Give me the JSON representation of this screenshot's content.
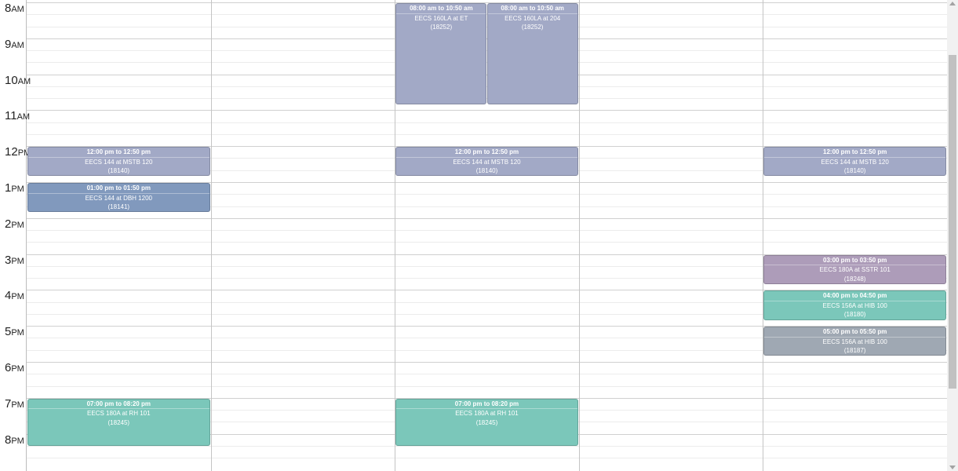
{
  "hours": [
    {
      "num": "8",
      "ampm": "AM"
    },
    {
      "num": "9",
      "ampm": "AM"
    },
    {
      "num": "10",
      "ampm": "AM"
    },
    {
      "num": "11",
      "ampm": "AM"
    },
    {
      "num": "12",
      "ampm": "PM"
    },
    {
      "num": "1",
      "ampm": "PM"
    },
    {
      "num": "2",
      "ampm": "PM"
    },
    {
      "num": "3",
      "ampm": "PM"
    },
    {
      "num": "4",
      "ampm": "PM"
    },
    {
      "num": "5",
      "ampm": "PM"
    },
    {
      "num": "6",
      "ampm": "PM"
    },
    {
      "num": "7",
      "ampm": "PM"
    },
    {
      "num": "8",
      "ampm": "PM"
    }
  ],
  "colors": {
    "blue_gray": "#a2a9c6",
    "steel_blue": "#8199bd",
    "teal": "#7bc7ba",
    "mauve": "#ad9cb9",
    "slate": "#9fa8b3"
  },
  "events": [
    {
      "id": "mon-144-a",
      "time": "12:00 pm to 12:50 pm",
      "title": "EECS 144 at MSTB 120",
      "code": "(18140)",
      "color": "blue_gray"
    },
    {
      "id": "mon-144-b",
      "time": "01:00 pm to 01:50 pm",
      "title": "EECS 144 at DBH 1200",
      "code": "(18141)",
      "color": "steel_blue"
    },
    {
      "id": "mon-180a",
      "time": "07:00 pm to 08:20 pm",
      "title": "EECS 180A at RH 101",
      "code": "(18245)",
      "color": "teal"
    },
    {
      "id": "wed-160la-et",
      "time": "08:00 am to 10:50 am",
      "title": "EECS 160LA at ET",
      "code": "(18252)",
      "color": "blue_gray"
    },
    {
      "id": "wed-160la-204",
      "time": "08:00 am to 10:50 am",
      "title": "EECS 160LA at 204",
      "code": "(18252)",
      "color": "blue_gray"
    },
    {
      "id": "wed-144",
      "time": "12:00 pm to 12:50 pm",
      "title": "EECS 144 at MSTB 120",
      "code": "(18140)",
      "color": "blue_gray"
    },
    {
      "id": "wed-180a",
      "time": "07:00 pm to 08:20 pm",
      "title": "EECS 180A at RH 101",
      "code": "(18245)",
      "color": "teal"
    },
    {
      "id": "fri-144",
      "time": "12:00 pm to 12:50 pm",
      "title": "EECS 144 at MSTB 120",
      "code": "(18140)",
      "color": "blue_gray"
    },
    {
      "id": "fri-180a",
      "time": "03:00 pm to 03:50 pm",
      "title": "EECS 180A at SSTR 101",
      "code": "(18248)",
      "color": "mauve"
    },
    {
      "id": "fri-156a-180",
      "time": "04:00 pm to 04:50 pm",
      "title": "EECS 156A at HIB 100",
      "code": "(18180)",
      "color": "teal"
    },
    {
      "id": "fri-156a-187",
      "time": "05:00 pm to 05:50 pm",
      "title": "EECS 156A at HIB 100",
      "code": "(18187)",
      "color": "slate"
    }
  ]
}
